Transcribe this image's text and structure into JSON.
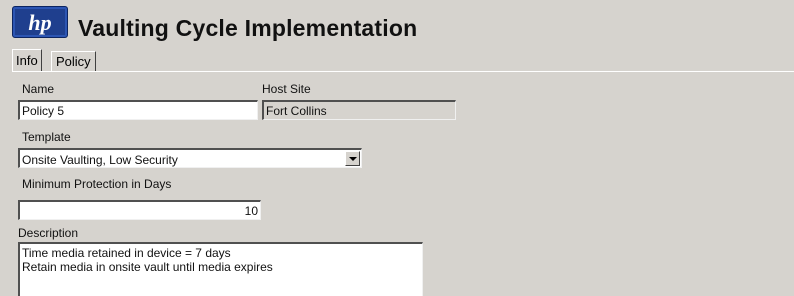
{
  "header": {
    "logo_text": "hp",
    "title": "Vaulting Cycle Implementation"
  },
  "tabs": [
    {
      "label": "Info",
      "selected": true
    },
    {
      "label": "Policy",
      "selected": false
    }
  ],
  "form": {
    "name_label": "Name",
    "name_value": "Policy 5",
    "host_site_label": "Host Site",
    "host_site_value": "Fort Collins",
    "template_label": "Template",
    "template_value": "Onsite Vaulting, Low Security",
    "min_protection_label": "Minimum Protection in Days",
    "min_protection_value": "10",
    "description_label": "Description",
    "description_lines": [
      "Time media retained in device = 7 days",
      "Retain media in onsite vault until media expires"
    ]
  },
  "colors": {
    "window_bg": "#d6d3ce",
    "logo_bg": "#1f3f8e"
  }
}
